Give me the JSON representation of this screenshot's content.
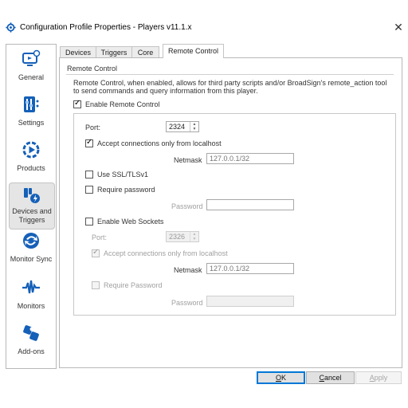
{
  "window": {
    "title": "Configuration Profile Properties - Players v11.1.x",
    "close_glyph": "✕"
  },
  "sidebar": {
    "items": [
      {
        "label": "General",
        "icon": "monitor-gear-icon"
      },
      {
        "label": "Settings",
        "icon": "sliders-icon"
      },
      {
        "label": "Products",
        "icon": "play-circle-icon"
      },
      {
        "label": "Devices and Triggers",
        "icon": "devices-triggers-icon",
        "active": true
      },
      {
        "label": "Monitor Sync",
        "icon": "sync-arrows-icon"
      },
      {
        "label": "Monitors",
        "icon": "waveform-icon"
      },
      {
        "label": "Add-ons",
        "icon": "puzzle-icon"
      }
    ]
  },
  "tabs": [
    {
      "label": "Devices"
    },
    {
      "label": "Triggers"
    },
    {
      "label": "Core"
    },
    {
      "label": "Remote Control",
      "selected": true
    }
  ],
  "remote_control": {
    "section_title": "Remote Control",
    "description": "Remote Control, when enabled, allows for third party scripts and/or BroadSign's remote_action tool to send commands and query information from this player.",
    "enable_label": "Enable Remote Control",
    "enable_checked": true,
    "port_label": "Port:",
    "port_value": "2324",
    "localhost_label": "Accept connections only from localhost",
    "localhost_checked": true,
    "netmask_label": "Netmask",
    "netmask_placeholder": "127.0.0.1/32",
    "ssl_label": "Use SSL/TLSv1",
    "ssl_checked": false,
    "require_password_label": "Require password",
    "require_password_checked": false,
    "password_label": "Password",
    "password_value": "",
    "websockets_label": "Enable Web Sockets",
    "websockets_checked": false,
    "ws_port_label": "Port:",
    "ws_port_value": "2326",
    "ws_localhost_label": "Accept connections only from localhost",
    "ws_localhost_checked": true,
    "ws_netmask_label": "Netmask",
    "ws_netmask_placeholder": "127.0.0.1/32",
    "ws_require_password_label": "Require Password",
    "ws_require_password_checked": false,
    "ws_password_label": "Password",
    "ws_password_value": ""
  },
  "buttons": {
    "ok": {
      "access_key": "O",
      "rest": "K"
    },
    "cancel": {
      "access_key": "C",
      "rest": "ancel"
    },
    "apply": {
      "access_key": "A",
      "rest": "pply"
    }
  },
  "colors": {
    "accent": "#1560b8",
    "default_button_border": "#0078d7"
  }
}
